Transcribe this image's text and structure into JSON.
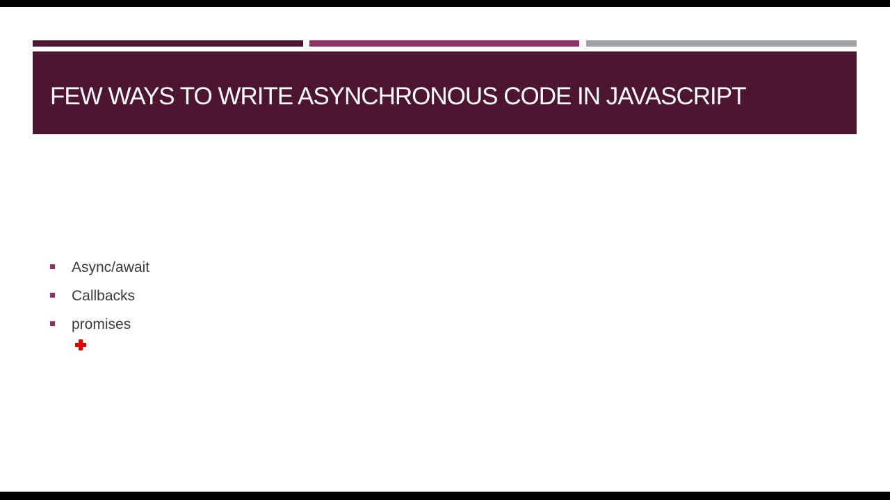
{
  "colors": {
    "accent_dark": "#4e1533",
    "accent_pink": "#8e3367",
    "accent_gray": "#9ea3a8",
    "title_band": "#4e1533",
    "bullet_marker": "#8e3367"
  },
  "slide": {
    "title": "FEW WAYS TO WRITE ASYNCHRONOUS CODE IN JAVASCRIPT",
    "bullets": [
      {
        "text": "Async/await"
      },
      {
        "text": "Callbacks"
      },
      {
        "text": "promises"
      }
    ]
  },
  "pointer": {
    "icon": "red-cross-pointer-icon"
  }
}
